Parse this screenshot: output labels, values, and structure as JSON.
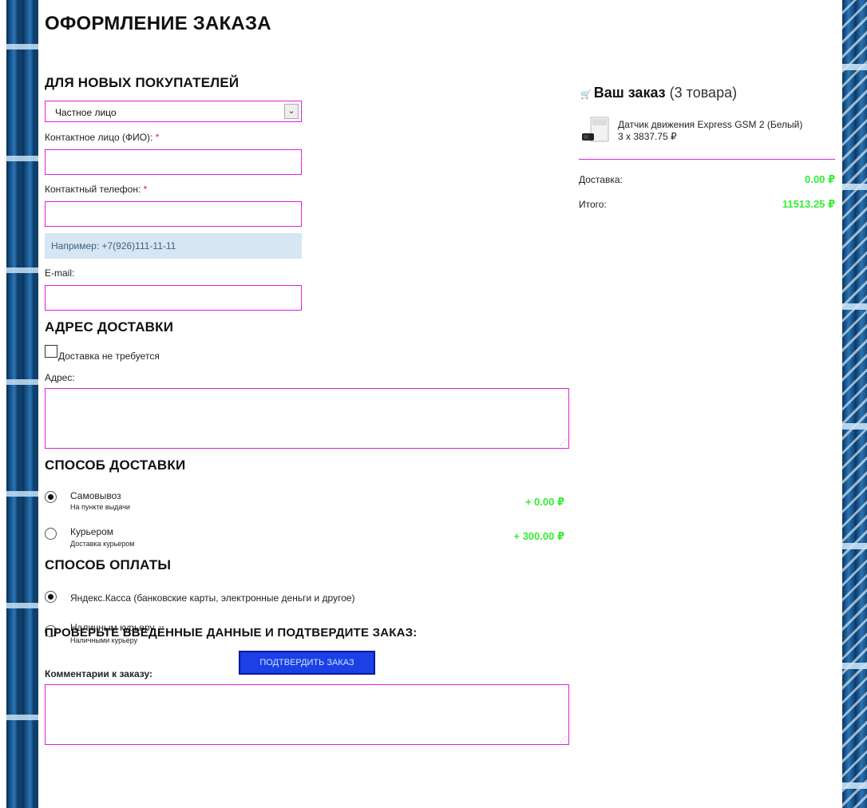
{
  "page_title": "ОФОРМЛЕНИЕ ЗАКАЗА",
  "new_buyers": {
    "heading": "ДЛЯ НОВЫХ ПОКУПАТЕЛЕЙ",
    "buyer_type_selected": "Частное лицо",
    "contact_label": "Контактное лицо (ФИО):",
    "phone_label": "Контактный телефон:",
    "required_mark": "*",
    "contact_value": "",
    "phone_value": "",
    "phone_hint": "Например: +7(926)111-11-11",
    "email_label": "E-mail:",
    "email_value": ""
  },
  "address": {
    "heading": "АДРЕС ДОСТАВКИ",
    "no_delivery_label": "Доставка не требуется",
    "no_delivery_checked": false,
    "address_label": "Адрес:",
    "address_value": ""
  },
  "delivery": {
    "heading": "СПОСОБ ДОСТАВКИ",
    "options": [
      {
        "title": "Самовывоз",
        "subtitle": "На пункте выдачи",
        "price": "+ 0.00 ₽",
        "selected": true
      },
      {
        "title": "Курьером",
        "subtitle": "Доставка курьером",
        "price": "+ 300.00 ₽",
        "selected": false
      }
    ]
  },
  "payment": {
    "heading": "СПОСОБ ОПЛАТЫ",
    "options": [
      {
        "title": "Яндекс.Касса (банковские карты, электронные деньги и другое)",
        "subtitle": "",
        "selected": true
      },
      {
        "title": "Наличным курьеру",
        "subtitle": "Наличными курьеру",
        "selected": false
      }
    ]
  },
  "comment": {
    "label": "Комментарии к заказу:",
    "value": ""
  },
  "confirm": {
    "heading": "ПРОВЕРЬТЕ ВВЕДЁННЫЕ ДАННЫЕ И ПОДТВЕРДИТЕ ЗАКАЗ:",
    "button_label": "ПОДТВЕРДИТЬ ЗАКАЗ"
  },
  "order": {
    "title": "Ваш заказ",
    "count_text": "(3 товара)",
    "item_name": "Датчик движения Express GSM 2 (Белый)",
    "item_qty": "3 x 3837.75 ₽",
    "delivery_label": "Доставка:",
    "delivery_value": "0.00 ₽",
    "total_label": "Итого:",
    "total_value": "11513.25 ₽"
  },
  "colors": {
    "field_border": "#e020e0",
    "price_green": "#33ee33",
    "button_bg": "#1a40e6",
    "hint_bg": "#d6e6f2"
  }
}
